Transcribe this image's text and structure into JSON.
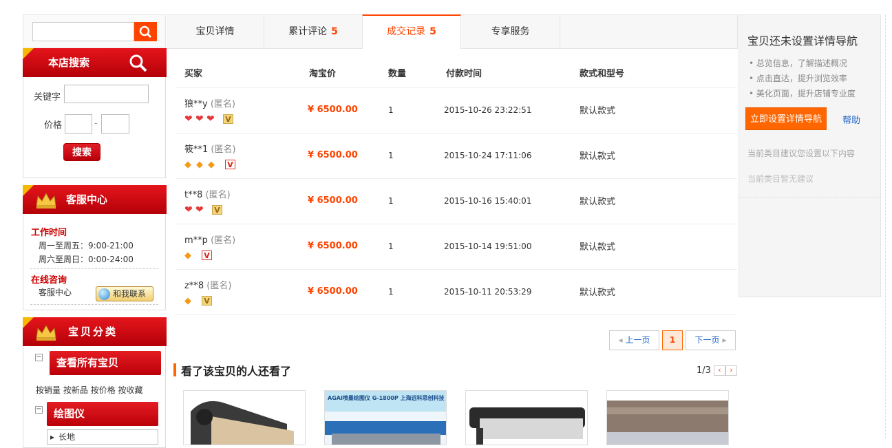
{
  "left": {
    "search_placeholder": "",
    "shop_search": {
      "title": "本店搜索",
      "keyword_label": "关键字",
      "price_label": "价格",
      "price_sep": "-",
      "button": "搜索"
    },
    "service": {
      "title": "客服中心",
      "work_time_title": "工作时间",
      "weekday": "周一至周五：9:00-21:00",
      "weekend": "周六至周日：0:00-24:00",
      "online_title": "在线咨询",
      "online_label": "客服中心",
      "contact_button": "和我联系"
    },
    "category": {
      "title": "宝贝分类",
      "view_all": "查看所有宝贝",
      "sort_links": [
        "按销量",
        "按新品",
        "按价格",
        "按收藏"
      ],
      "sub_category": "绘图仪",
      "sub_item": "长地"
    }
  },
  "tabs": [
    {
      "label": "宝贝详情",
      "count": ""
    },
    {
      "label": "累计评论",
      "count": "5"
    },
    {
      "label": "成交记录",
      "count": "5"
    },
    {
      "label": "专享服务",
      "count": ""
    }
  ],
  "table": {
    "headers": [
      "买家",
      "淘宝价",
      "数量",
      "付款时间",
      "款式和型号"
    ],
    "rows": [
      {
        "buyer": "狼**y",
        "anon": "(匿名)",
        "price": "¥ 6500.00",
        "qty": "1",
        "time": "2015-10-26 23:22:51",
        "model": "默认款式",
        "level_icon": "heart",
        "level_count": 3,
        "vip": "gold"
      },
      {
        "buyer": "筱**1",
        "anon": "(匿名)",
        "price": "¥ 6500.00",
        "qty": "1",
        "time": "2015-10-24 17:11:06",
        "model": "默认款式",
        "level_icon": "diamond",
        "level_count": 3,
        "vip": "red"
      },
      {
        "buyer": "t**8",
        "anon": "(匿名)",
        "price": "¥ 6500.00",
        "qty": "1",
        "time": "2015-10-16 15:40:01",
        "model": "默认款式",
        "level_icon": "heart",
        "level_count": 2,
        "vip": "gold"
      },
      {
        "buyer": "m**p",
        "anon": "(匿名)",
        "price": "¥ 6500.00",
        "qty": "1",
        "time": "2015-10-14 19:51:00",
        "model": "默认款式",
        "level_icon": "diamond",
        "level_count": 1,
        "vip": "red"
      },
      {
        "buyer": "z**8",
        "anon": "(匿名)",
        "price": "¥ 6500.00",
        "qty": "1",
        "time": "2015-10-11 20:53:29",
        "model": "默认款式",
        "level_icon": "diamond",
        "level_count": 1,
        "vip": "gold"
      }
    ]
  },
  "pagination": {
    "prev": "上一页",
    "current": "1",
    "next": "下一页"
  },
  "also_viewed": {
    "title": "看了该宝贝的人还看了",
    "page": "1/3",
    "thumbs": [
      {
        "caption": ""
      },
      {
        "caption": "AGAI喷墨绘图仪 G-1800P 上海远科思创科技"
      },
      {
        "caption": ""
      },
      {
        "caption": ""
      }
    ]
  },
  "aside": {
    "title": "宝贝还未设置详情导航",
    "tips": [
      "总览信息，了解描述概况",
      "点击直达，提升浏览效率",
      "美化页面，提升店铺专业度"
    ],
    "setup_button": "立即设置详情导航",
    "help": "帮助",
    "note1": "当前类目建议您设置以下内容",
    "note2": "当前类目暂无建议"
  },
  "colors": {
    "accent": "#ff4400",
    "brand_red": "#cc0000",
    "link": "#1e64c8"
  }
}
